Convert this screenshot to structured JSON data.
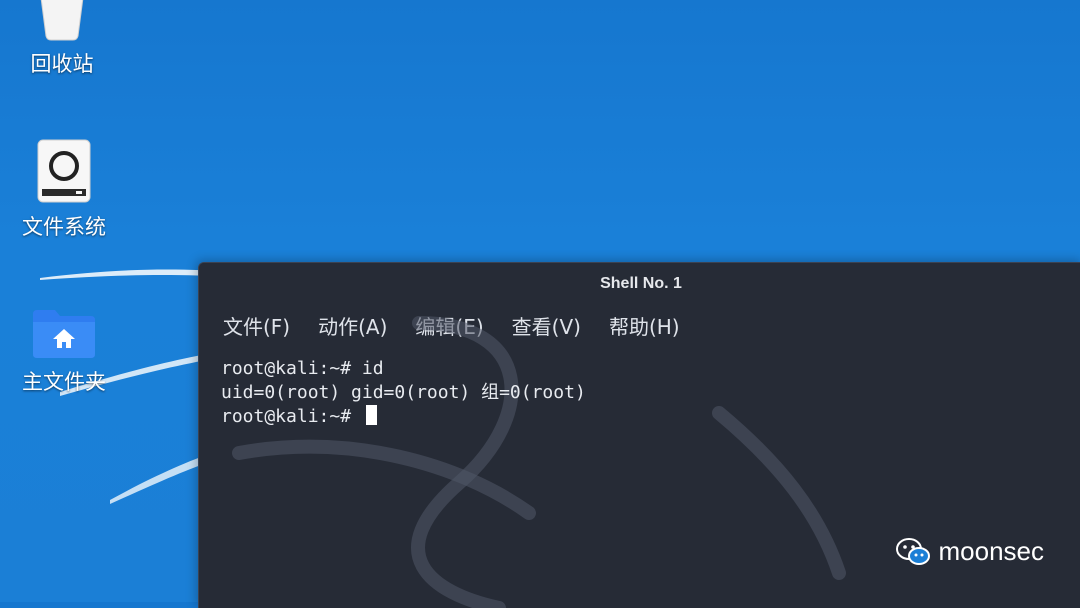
{
  "desktop": {
    "icons": [
      {
        "label": "回收站",
        "icon": "trash-icon"
      },
      {
        "label": "文件系统",
        "icon": "drive-icon"
      },
      {
        "label": "主文件夹",
        "icon": "home-folder-icon"
      }
    ]
  },
  "terminal": {
    "title": "Shell No. 1",
    "menu": [
      "文件(F)",
      "动作(A)",
      "编辑(E)",
      "查看(V)",
      "帮助(H)"
    ],
    "lines": [
      "root@kali:~# id",
      "uid=0(root) gid=0(root) 组=0(root)",
      "root@kali:~# "
    ]
  },
  "watermark": {
    "text": "moonsec",
    "icon": "wechat-icon"
  },
  "colors": {
    "desktop_bg": "#1a7fd6",
    "terminal_bg": "#262b36",
    "text": "#e8ebf0",
    "folder": "#2f7df0"
  }
}
